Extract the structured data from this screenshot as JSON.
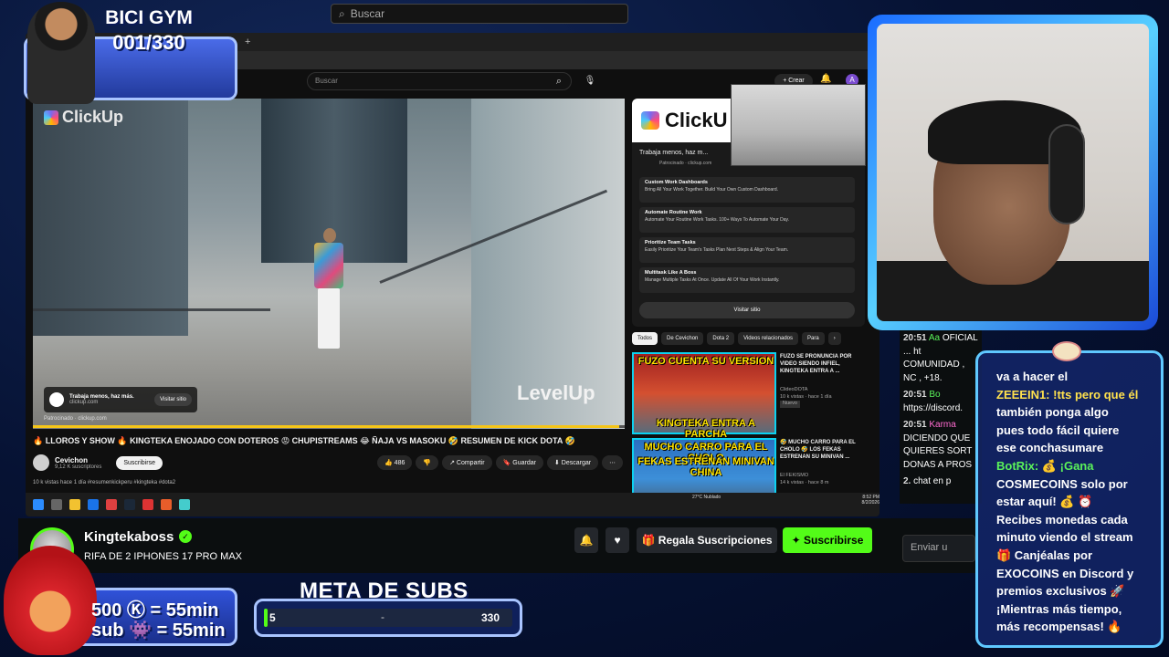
{
  "top_search": {
    "placeholder": "Buscar"
  },
  "browser": {
    "yt_search_placeholder": "Buscar",
    "create_label": "+ Crear",
    "avatar_letter": "A"
  },
  "player": {
    "brand": "ClickUp",
    "watermark": "LevelUp",
    "ad_text": "Trabaja menos, haz más.",
    "ad_domain": "clickup.com",
    "ad_button": "Visitar sitio",
    "ad_footer": "Patrocinado · clickup.com",
    "progress": 0.99
  },
  "video": {
    "title": "🔥 LLOROS Y SHOW 🔥 KINGTEKA ENOJADO CON DOTEROS 😡 CHUPISTREAMS 😂 ÑAJA VS MASOKU 🤣 RESUMEN DE KICK DOTA 🤣",
    "channel": "Cevichon",
    "channel_subs": "9,12 K suscriptores",
    "subscribe": "Suscribirse",
    "likes": "486",
    "share": "Compartir",
    "save": "Guardar",
    "download": "Descargar",
    "description": "10 k vistas  hace 1 día  #resumenkickperu #kingteka #dota2"
  },
  "ad_panel": {
    "logo": "ClickU",
    "headline": "Trabaja menos, haz m...",
    "sponsor": "Patrocinado · clickup.com",
    "items": [
      {
        "title": "Custom Work Dashboards",
        "desc": "Bring All Your Work Together. Build Your Own Custom Dashboard."
      },
      {
        "title": "Automate Routine Work",
        "desc": "Automate Your Routine Work Tasks. 100+ Ways To Automate Your Day."
      },
      {
        "title": "Prioritize Team Tasks",
        "desc": "Easily Prioritize Your Team's Tasks Plan Next Steps & Align Your Team."
      },
      {
        "title": "Multitask Like A Boss",
        "desc": "Manage Multiple Tasks At Once. Update All Of Your Work Instantly."
      }
    ],
    "visit": "Visitar sitio"
  },
  "chips": [
    "Todos",
    "De Cevichon",
    "Dota 2",
    "Videos relacionados",
    "Para"
  ],
  "recommendations": [
    {
      "thumb_top": "FUZO CUENTA SU VERSION",
      "thumb_bottom": "KINGTEKA ENTRA A PARCHA",
      "title": "FUZO SE PRONUNCIA POR VIDEO SIENDO INFIEL, KINGTEKA ENTRA A ...",
      "channel": "ClideoDOTA",
      "views": "10 k vistas · hace 1 día",
      "badge": "Nuevo"
    },
    {
      "thumb_top": "MUCHO CARRO PARA EL CHOLO",
      "thumb_bottom": "FEKAS ESTRENAN MINIVAN CHINA",
      "title": "🤣 MUCHO CARRO PARA EL CHOLO 🤣 LOS FEKAS ESTRENAN SU MINIVAN ...",
      "channel": "El FEKISMO",
      "views": "14 k vistas · hace 8 m",
      "badge": ""
    }
  ],
  "taskbar": {
    "weather": "27°C Nublado",
    "clock": "8:52 PM 8/2/2026"
  },
  "kick": {
    "streamer": "Kingtekaboss",
    "verified": "✓",
    "stream_title": "RIFA DE 2 IPHONES 17 PRO MAX",
    "gift_subs": "Regala Suscripciones",
    "subscribe": "Suscribirse",
    "chat_placeholder": "Enviar u"
  },
  "chat_left": [
    {
      "time": "20:51",
      "user": "Aa",
      "text": "OFICIAL ... ht COMUNIDAD , NC , +18."
    },
    {
      "time": "20:51",
      "user": "Bo",
      "text": "https://discord."
    },
    {
      "time": "20:51",
      "user": "Karma",
      "text": "DICIENDO QUE QUIERES SORT DONAS A PROS"
    },
    {
      "time": "2.",
      "user": "",
      "text": "chat en p"
    }
  ],
  "chat_box": [
    {
      "text": "va a hacer el",
      "style": ""
    },
    {
      "text": "ZEEEIN1: !tts pero que él",
      "style": ""
    },
    {
      "text": "también ponga algo",
      "style": ""
    },
    {
      "text": "pues todo fácil quiere",
      "style": ""
    },
    {
      "text": "ese conchasumare",
      "style": ""
    },
    {
      "text": "BotRix: 💰 ¡Gana",
      "style": "g"
    },
    {
      "text": "COSMECOINS solo por",
      "style": ""
    },
    {
      "text": "estar aquí! 💰 ⏰",
      "style": ""
    },
    {
      "text": "Recibes monedas cada",
      "style": ""
    },
    {
      "text": "minuto viendo el stream",
      "style": ""
    },
    {
      "text": "🎁 Canjéalas por",
      "style": ""
    },
    {
      "text": "EXOCOINS en Discord y",
      "style": ""
    },
    {
      "text": "premios exclusivos 🚀",
      "style": ""
    },
    {
      "text": "¡Mientras más tiempo,",
      "style": ""
    },
    {
      "text": "más recompensas! 🔥",
      "style": ""
    }
  ],
  "gym": {
    "title": "BICI GYM",
    "count": "001/330"
  },
  "subs_prices": {
    "line1": "500 Ⓚ = 55min",
    "line2": "sub 👾 = 55min"
  },
  "meta": {
    "title": "META DE SUBS",
    "start": "5",
    "dash": "-",
    "end": "330",
    "progress": 0.015
  },
  "colors": {
    "kick_green": "#53fc18",
    "frame_blue": "#5fc8ff",
    "accent_yellow": "#ffe14d"
  }
}
